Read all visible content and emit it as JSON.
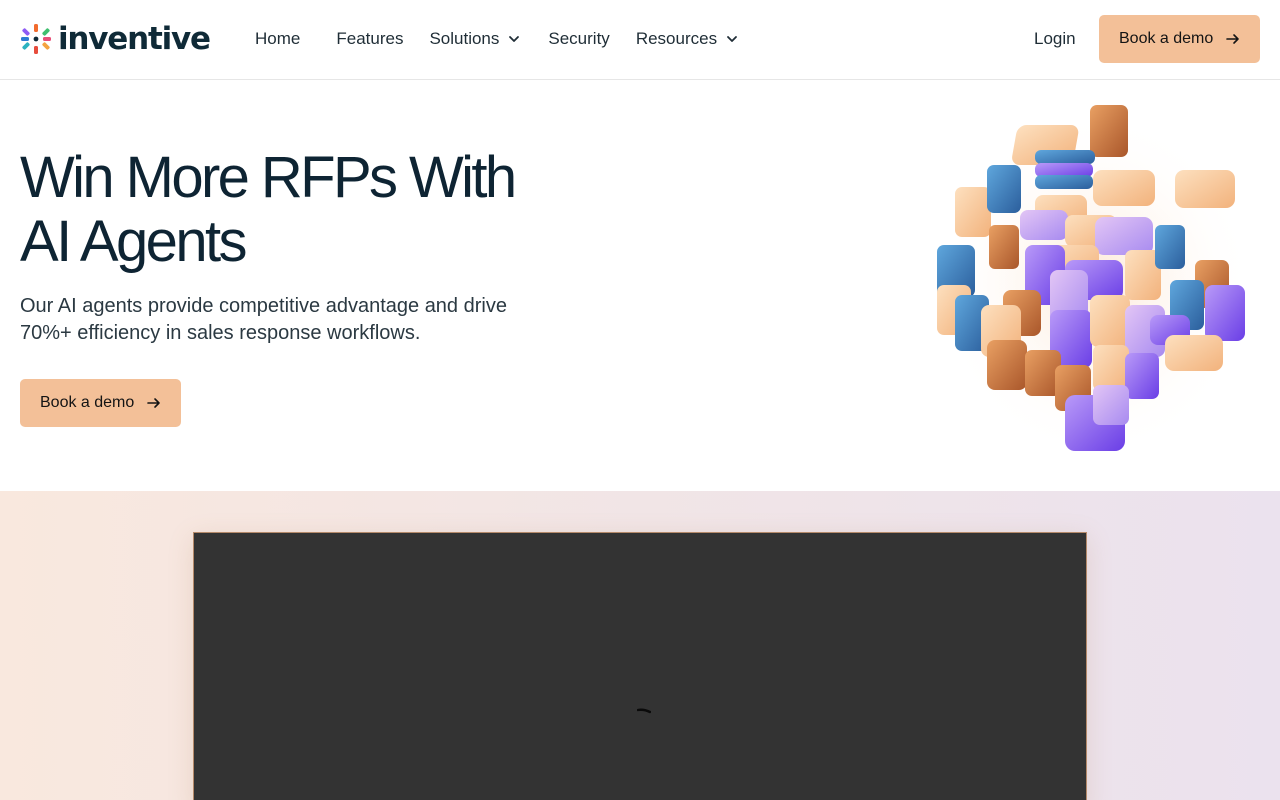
{
  "brand": {
    "name": "inventive",
    "accent": "#f3c098",
    "text_color": "#0e2433"
  },
  "nav": {
    "items": [
      {
        "label": "Home"
      },
      {
        "label": "Features"
      },
      {
        "label": "Solutions",
        "icon": "chevron-down-icon"
      },
      {
        "label": "Security"
      },
      {
        "label": "Resources",
        "icon": "chevron-down-icon"
      }
    ],
    "login_label": "Login",
    "cta_label": "Book a demo"
  },
  "hero": {
    "title_line1": "Win More RFPs With",
    "title_line2": "AI Agents",
    "subtitle_line1": "Our AI agents provide competitive advantage and drive",
    "subtitle_line2": "70%+ efficiency in sales response workflows.",
    "cta_label": "Book a demo",
    "illustration": "3d-tile-cube"
  },
  "video": {
    "state": "loading",
    "background": "#333333"
  }
}
